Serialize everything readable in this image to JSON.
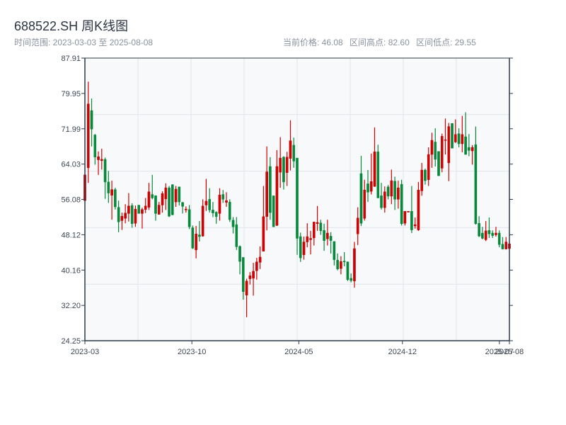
{
  "header": {
    "title": "688522.SH 周K线图",
    "range_label": "时间范围: 2023-03-03 至 2025-08-08",
    "current_price": "当前价格: 46.08",
    "range_high": "区间高点: 82.60",
    "range_low": "区间低点: 29.55"
  },
  "colors": {
    "up": "#d40000",
    "down": "#07883a",
    "plot_bg": "#f7f9fb",
    "axis": "#2d3a4a",
    "grid": "#e1e5ea"
  },
  "chart_data": {
    "type": "candlestick",
    "frequency": "weekly",
    "start_date": "2023-03-03",
    "end_date": "2025-08-08",
    "ylim": [
      24.25,
      87.91
    ],
    "y_ticks": [
      "87.91",
      "79.95",
      "71.99",
      "64.03",
      "56.08",
      "48.12",
      "40.16",
      "32.20",
      "24.25"
    ],
    "x_ticks": [
      {
        "label": "2023-03",
        "date": "2023-03-03"
      },
      {
        "label": "2023-10",
        "date": "2023-10-13"
      },
      {
        "label": "2024-05",
        "date": "2024-05-24"
      },
      {
        "label": "2024-12",
        "date": "2024-12-27"
      },
      {
        "label": "2025-07",
        "date": "2025-07-18"
      },
      {
        "label": "2025-08",
        "date": "2025-08-08"
      }
    ],
    "grid": true,
    "ohlc_columns": [
      "open",
      "high",
      "low",
      "close"
    ],
    "ohlc": [
      [
        55.8,
        61.6,
        55.8,
        61.6
      ],
      [
        63.2,
        82.6,
        59.8,
        77.6
      ],
      [
        76.1,
        78.8,
        68.0,
        71.9
      ],
      [
        70.6,
        70.8,
        63.9,
        65.6
      ],
      [
        65.0,
        66.9,
        61.6,
        65.7
      ],
      [
        64.8,
        67.5,
        62.8,
        65.1
      ],
      [
        65.1,
        65.5,
        56.2,
        60.0
      ],
      [
        60.0,
        62.5,
        55.3,
        57.5
      ],
      [
        57.0,
        60.3,
        51.5,
        58.3
      ],
      [
        58.3,
        58.7,
        53.8,
        54.4
      ],
      [
        54.3,
        55.8,
        48.7,
        51.0
      ],
      [
        51.3,
        53.1,
        49.2,
        52.3
      ],
      [
        51.8,
        55.0,
        50.7,
        53.0
      ],
      [
        52.9,
        57.5,
        51.1,
        54.6
      ],
      [
        54.7,
        55.2,
        49.7,
        50.6
      ],
      [
        50.7,
        54.7,
        49.9,
        53.9
      ],
      [
        54.8,
        54.8,
        52.9,
        52.9
      ],
      [
        52.9,
        54.2,
        49.5,
        53.8
      ],
      [
        53.8,
        56.4,
        53.0,
        54.6
      ],
      [
        54.3,
        59.8,
        53.7,
        57.8
      ],
      [
        57.2,
        61.6,
        56.1,
        56.4
      ],
      [
        56.9,
        57.0,
        51.3,
        52.9
      ],
      [
        52.7,
        55.5,
        52.7,
        54.8
      ],
      [
        54.8,
        57.9,
        53.1,
        57.4
      ],
      [
        56.2,
        59.7,
        53.7,
        58.7
      ],
      [
        58.7,
        59.1,
        52.1,
        52.3
      ],
      [
        59.4,
        59.5,
        52.5,
        52.6
      ],
      [
        55.5,
        59.1,
        54.4,
        58.4
      ],
      [
        58.9,
        58.9,
        54.7,
        55.5
      ],
      [
        55.4,
        55.5,
        52.9,
        54.5
      ],
      [
        53.7,
        54.5,
        53.1,
        53.9
      ],
      [
        53.8,
        54.8,
        49.4,
        49.9
      ],
      [
        49.7,
        50.2,
        44.9,
        45.1
      ],
      [
        44.7,
        50.1,
        42.8,
        48.3
      ],
      [
        48.1,
        51.2,
        46.6,
        47.7
      ],
      [
        47.8,
        56.1,
        47.7,
        54.6
      ],
      [
        54.8,
        60.7,
        53.5,
        55.7
      ],
      [
        56.1,
        58.6,
        53.1,
        53.7
      ],
      [
        53.7,
        55.5,
        52.1,
        53.0
      ],
      [
        53.2,
        53.4,
        50.6,
        52.2
      ],
      [
        52.9,
        58.6,
        51.3,
        57.1
      ],
      [
        57.2,
        58.2,
        55.3,
        56.1
      ],
      [
        55.4,
        57.7,
        54.4,
        55.8
      ],
      [
        55.5,
        56.1,
        51.0,
        51.5
      ],
      [
        51.4,
        52.1,
        48.4,
        49.9
      ],
      [
        50.4,
        52.1,
        44.7,
        45.4
      ],
      [
        45.5,
        45.7,
        39.2,
        42.1
      ],
      [
        43.0,
        43.1,
        33.5,
        35.3
      ],
      [
        34.5,
        38.2,
        29.55,
        37.7
      ],
      [
        38.2,
        39.7,
        36.9,
        38.9
      ],
      [
        38.3,
        41.8,
        34.4,
        39.9
      ],
      [
        40.0,
        42.9,
        38.0,
        42.0
      ],
      [
        41.9,
        45.5,
        40.4,
        43.1
      ],
      [
        44.4,
        59.1,
        44.4,
        52.2
      ],
      [
        52.2,
        68.0,
        49.1,
        62.3
      ],
      [
        63.5,
        65.6,
        51.5,
        53.1
      ],
      [
        56.9,
        56.9,
        49.9,
        49.9
      ],
      [
        50.2,
        67.2,
        50.1,
        63.5
      ],
      [
        62.2,
        70.1,
        58.7,
        65.4
      ],
      [
        65.6,
        65.8,
        58.3,
        60.0
      ],
      [
        62.1,
        66.8,
        59.1,
        65.6
      ],
      [
        65.3,
        73.9,
        62.6,
        69.3
      ],
      [
        68.3,
        70.0,
        63.2,
        64.7
      ],
      [
        65.4,
        65.4,
        43.6,
        47.3
      ],
      [
        47.7,
        48.6,
        42.0,
        42.9
      ],
      [
        43.6,
        47.7,
        42.5,
        46.5
      ],
      [
        46.5,
        50.7,
        45.3,
        47.7
      ],
      [
        47.0,
        49.0,
        43.7,
        47.3
      ],
      [
        47.4,
        51.0,
        45.7,
        51.0
      ],
      [
        50.6,
        54.6,
        49.0,
        50.9
      ],
      [
        50.8,
        51.5,
        48.1,
        49.0
      ],
      [
        49.1,
        50.6,
        44.5,
        46.8
      ],
      [
        47.2,
        51.5,
        45.7,
        48.5
      ],
      [
        47.8,
        48.7,
        43.9,
        46.8
      ],
      [
        46.6,
        46.6,
        41.2,
        42.5
      ],
      [
        42.4,
        43.9,
        40.1,
        40.4
      ],
      [
        40.5,
        43.3,
        39.2,
        42.1
      ],
      [
        42.2,
        44.2,
        41.0,
        42.0
      ],
      [
        42.0,
        42.1,
        37.7,
        38.0
      ],
      [
        38.3,
        39.4,
        37.4,
        37.8
      ],
      [
        37.7,
        46.5,
        36.2,
        45.0
      ],
      [
        48.3,
        54.3,
        45.8,
        51.9
      ],
      [
        61.9,
        65.9,
        50.1,
        50.7
      ],
      [
        51.8,
        60.5,
        51.3,
        58.2
      ],
      [
        59.6,
        62.7,
        55.5,
        57.7
      ],
      [
        57.9,
        66.4,
        57.2,
        60.1
      ],
      [
        59.0,
        72.3,
        58.9,
        66.8
      ],
      [
        66.8,
        68.4,
        56.4,
        56.4
      ],
      [
        56.9,
        59.8,
        53.8,
        54.2
      ],
      [
        54.2,
        59.0,
        53.1,
        57.8
      ],
      [
        58.9,
        59.3,
        56.1,
        56.8
      ],
      [
        56.8,
        62.8,
        55.0,
        60.3
      ],
      [
        60.2,
        61.2,
        53.7,
        56.1
      ],
      [
        56.1,
        60.3,
        54.0,
        58.7
      ],
      [
        59.5,
        60.5,
        50.2,
        50.6
      ],
      [
        50.7,
        53.4,
        50.2,
        53.4
      ],
      [
        53.2,
        53.4,
        53.2,
        53.4
      ],
      [
        53.4,
        59.1,
        48.5,
        49.2
      ],
      [
        50.1,
        52.0,
        49.5,
        50.4
      ],
      [
        49.2,
        60.0,
        49.0,
        58.2
      ],
      [
        58.0,
        64.3,
        56.9,
        62.7
      ],
      [
        62.7,
        63.0,
        59.4,
        60.3
      ],
      [
        60.5,
        67.8,
        59.1,
        66.2
      ],
      [
        66.2,
        71.1,
        63.2,
        69.4
      ],
      [
        69.0,
        72.1,
        63.5,
        65.1
      ],
      [
        66.9,
        66.9,
        61.4,
        61.4
      ],
      [
        63.1,
        70.9,
        62.2,
        70.3
      ],
      [
        69.4,
        74.3,
        66.2,
        69.5
      ],
      [
        64.3,
        73.3,
        60.2,
        72.5
      ],
      [
        73.2,
        73.2,
        67.6,
        67.6
      ],
      [
        69.0,
        74.1,
        68.8,
        70.7
      ],
      [
        70.9,
        72.1,
        67.8,
        68.6
      ],
      [
        68.6,
        74.9,
        66.7,
        70.7
      ],
      [
        70.2,
        75.7,
        66.2,
        66.2
      ],
      [
        67.8,
        70.8,
        65.8,
        67.1
      ],
      [
        67.0,
        68.3,
        63.9,
        67.8
      ],
      [
        68.4,
        72.5,
        50.4,
        50.6
      ],
      [
        50.7,
        52.3,
        47.6,
        47.8
      ],
      [
        48.5,
        49.9,
        47.1,
        47.3
      ],
      [
        47.0,
        51.2,
        46.7,
        49.0
      ],
      [
        49.1,
        52.0,
        47.4,
        48.3
      ],
      [
        48.5,
        49.1,
        47.4,
        47.9
      ],
      [
        48.1,
        49.9,
        47.7,
        48.5
      ],
      [
        48.5,
        49.1,
        45.3,
        45.9
      ],
      [
        46.0,
        47.6,
        44.8,
        44.9
      ],
      [
        44.9,
        47.6,
        44.8,
        46.5
      ],
      [
        45.0,
        46.5,
        44.8,
        46.08
      ]
    ]
  }
}
